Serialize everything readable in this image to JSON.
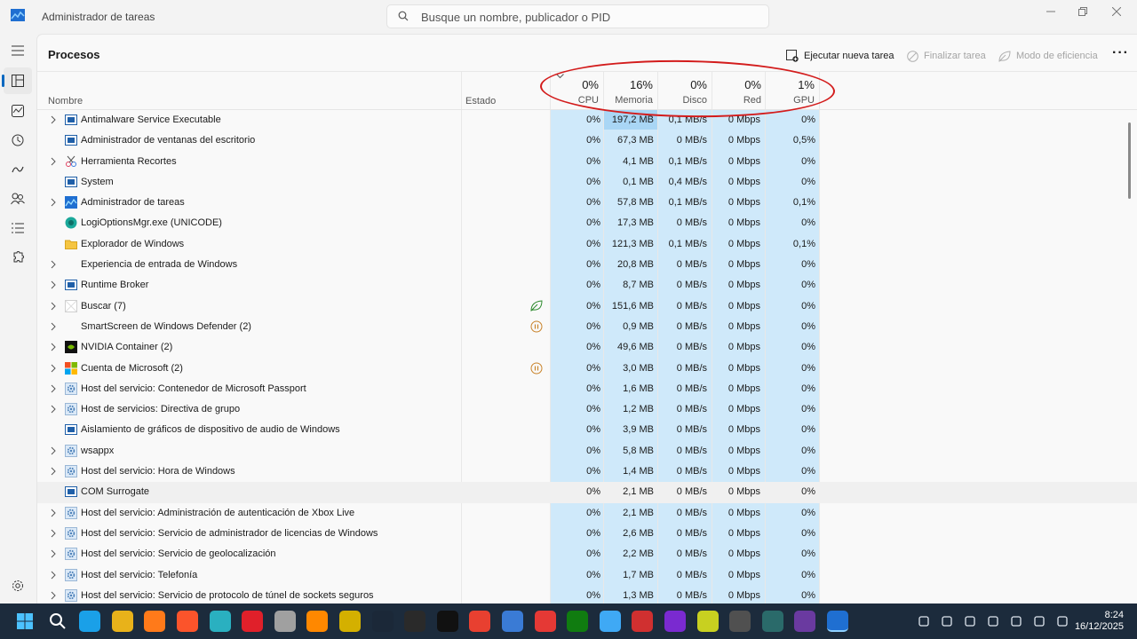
{
  "window": {
    "title": "Administrador de tareas"
  },
  "search": {
    "placeholder": "Busque un nombre, publicador o PID"
  },
  "page": {
    "title": "Procesos"
  },
  "toolbar": {
    "run_new_task": "Ejecutar nueva tarea",
    "end_task": "Finalizar tarea",
    "efficiency_mode": "Modo de eficiencia"
  },
  "columns": {
    "name": "Nombre",
    "status": "Estado",
    "cpu": {
      "pct": "0%",
      "label": "CPU"
    },
    "memory": {
      "pct": "16%",
      "label": "Memoria"
    },
    "disk": {
      "pct": "0%",
      "label": "Disco"
    },
    "network": {
      "pct": "0%",
      "label": "Red"
    },
    "gpu": {
      "pct": "1%",
      "label": "GPU"
    }
  },
  "processes": [
    {
      "name": "Antimalware Service Executable",
      "cpu": "0%",
      "mem": "197,2 MB",
      "disk": "0,1 MB/s",
      "net": "0 Mbps",
      "gpu": "0%",
      "expand": true,
      "icon": "window-icon",
      "status": ""
    },
    {
      "name": "Administrador de ventanas del escritorio",
      "cpu": "0%",
      "mem": "67,3 MB",
      "disk": "0 MB/s",
      "net": "0 Mbps",
      "gpu": "0,5%",
      "expand": false,
      "icon": "window-icon",
      "status": ""
    },
    {
      "name": "Herramienta Recortes",
      "cpu": "0%",
      "mem": "4,1 MB",
      "disk": "0,1 MB/s",
      "net": "0 Mbps",
      "gpu": "0%",
      "expand": true,
      "icon": "snip-icon",
      "status": ""
    },
    {
      "name": "System",
      "cpu": "0%",
      "mem": "0,1 MB",
      "disk": "0,4 MB/s",
      "net": "0 Mbps",
      "gpu": "0%",
      "expand": false,
      "icon": "window-icon",
      "status": ""
    },
    {
      "name": "Administrador de tareas",
      "cpu": "0%",
      "mem": "57,8 MB",
      "disk": "0,1 MB/s",
      "net": "0 Mbps",
      "gpu": "0,1%",
      "expand": true,
      "icon": "taskmgr-icon",
      "status": ""
    },
    {
      "name": "LogiOptionsMgr.exe (UNICODE)",
      "cpu": "0%",
      "mem": "17,3 MB",
      "disk": "0 MB/s",
      "net": "0 Mbps",
      "gpu": "0%",
      "expand": false,
      "icon": "logi-icon",
      "status": ""
    },
    {
      "name": "Explorador de Windows",
      "cpu": "0%",
      "mem": "121,3 MB",
      "disk": "0,1 MB/s",
      "net": "0 Mbps",
      "gpu": "0,1%",
      "expand": false,
      "icon": "folder-icon",
      "status": ""
    },
    {
      "name": "Experiencia de entrada de Windows",
      "cpu": "0%",
      "mem": "20,8 MB",
      "disk": "0 MB/s",
      "net": "0 Mbps",
      "gpu": "0%",
      "expand": true,
      "icon": "none",
      "status": ""
    },
    {
      "name": "Runtime Broker",
      "cpu": "0%",
      "mem": "8,7 MB",
      "disk": "0 MB/s",
      "net": "0 Mbps",
      "gpu": "0%",
      "expand": true,
      "icon": "window-icon",
      "status": ""
    },
    {
      "name": "Buscar (7)",
      "cpu": "0%",
      "mem": "151,6 MB",
      "disk": "0 MB/s",
      "net": "0 Mbps",
      "gpu": "0%",
      "expand": true,
      "icon": "blank-icon",
      "status": "leaf"
    },
    {
      "name": "SmartScreen de Windows Defender (2)",
      "cpu": "0%",
      "mem": "0,9 MB",
      "disk": "0 MB/s",
      "net": "0 Mbps",
      "gpu": "0%",
      "expand": true,
      "icon": "none",
      "status": "pause"
    },
    {
      "name": "NVIDIA Container (2)",
      "cpu": "0%",
      "mem": "49,6 MB",
      "disk": "0 MB/s",
      "net": "0 Mbps",
      "gpu": "0%",
      "expand": true,
      "icon": "nvidia-icon",
      "status": ""
    },
    {
      "name": "Cuenta de Microsoft (2)",
      "cpu": "0%",
      "mem": "3,0 MB",
      "disk": "0 MB/s",
      "net": "0 Mbps",
      "gpu": "0%",
      "expand": true,
      "icon": "ms-icon",
      "status": "pause"
    },
    {
      "name": "Host del servicio: Contenedor de Microsoft Passport",
      "cpu": "0%",
      "mem": "1,6 MB",
      "disk": "0 MB/s",
      "net": "0 Mbps",
      "gpu": "0%",
      "expand": true,
      "icon": "gear-icon",
      "status": ""
    },
    {
      "name": "Host de servicios: Directiva de grupo",
      "cpu": "0%",
      "mem": "1,2 MB",
      "disk": "0 MB/s",
      "net": "0 Mbps",
      "gpu": "0%",
      "expand": true,
      "icon": "gear-icon",
      "status": ""
    },
    {
      "name": "Aislamiento de gráficos de dispositivo de audio de Windows",
      "cpu": "0%",
      "mem": "3,9 MB",
      "disk": "0 MB/s",
      "net": "0 Mbps",
      "gpu": "0%",
      "expand": false,
      "icon": "window-icon",
      "status": ""
    },
    {
      "name": "wsappx",
      "cpu": "0%",
      "mem": "5,8 MB",
      "disk": "0 MB/s",
      "net": "0 Mbps",
      "gpu": "0%",
      "expand": true,
      "icon": "gear-icon",
      "status": ""
    },
    {
      "name": "Host del servicio: Hora de Windows",
      "cpu": "0%",
      "mem": "1,4 MB",
      "disk": "0 MB/s",
      "net": "0 Mbps",
      "gpu": "0%",
      "expand": true,
      "icon": "gear-icon",
      "status": ""
    },
    {
      "name": "COM Surrogate",
      "cpu": "0%",
      "mem": "2,1 MB",
      "disk": "0 MB/s",
      "net": "0 Mbps",
      "gpu": "0%",
      "expand": false,
      "icon": "window-icon",
      "status": "",
      "hover": true
    },
    {
      "name": "Host del servicio: Administración de autenticación de Xbox Live",
      "cpu": "0%",
      "mem": "2,1 MB",
      "disk": "0 MB/s",
      "net": "0 Mbps",
      "gpu": "0%",
      "expand": true,
      "icon": "gear-icon",
      "status": ""
    },
    {
      "name": "Host del servicio: Servicio de administrador de licencias de Windows",
      "cpu": "0%",
      "mem": "2,6 MB",
      "disk": "0 MB/s",
      "net": "0 Mbps",
      "gpu": "0%",
      "expand": true,
      "icon": "gear-icon",
      "status": ""
    },
    {
      "name": "Host del servicio: Servicio de geolocalización",
      "cpu": "0%",
      "mem": "2,2 MB",
      "disk": "0 MB/s",
      "net": "0 Mbps",
      "gpu": "0%",
      "expand": true,
      "icon": "gear-icon",
      "status": ""
    },
    {
      "name": "Host del servicio: Telefonía",
      "cpu": "0%",
      "mem": "1,7 MB",
      "disk": "0 MB/s",
      "net": "0 Mbps",
      "gpu": "0%",
      "expand": true,
      "icon": "gear-icon",
      "status": ""
    },
    {
      "name": "Host del servicio: Servicio de protocolo de túnel de sockets seguros",
      "cpu": "0%",
      "mem": "1,3 MB",
      "disk": "0 MB/s",
      "net": "0 Mbps",
      "gpu": "0%",
      "expand": true,
      "icon": "gear-icon",
      "status": ""
    }
  ],
  "taskbar": {
    "apps": [
      "start-icon",
      "search-icon",
      "edge-icon",
      "chrome-icon",
      "firefox-icon",
      "brave-icon",
      "app-c-icon",
      "opera-icon",
      "app-astronaut-icon",
      "vlc-icon",
      "app-game-icon",
      "steam-icon",
      "epic-games-icon",
      "amazon-games-icon",
      "ea-icon",
      "app-a-icon",
      "anydesk-icon",
      "xbox-icon",
      "app-b-icon",
      "gamepad-icon",
      "app-ring-icon",
      "app-y-icon",
      "app-obs-icon",
      "app-terminal-icon",
      "app-n-icon",
      "taskmgr-icon"
    ],
    "time": "8:24",
    "date": "16/12/2025"
  },
  "colors": {
    "accent": "#0067c0",
    "shade": "#cfe9fa",
    "annotation": "#d31c1c",
    "taskbar": "#1c2b3c"
  }
}
